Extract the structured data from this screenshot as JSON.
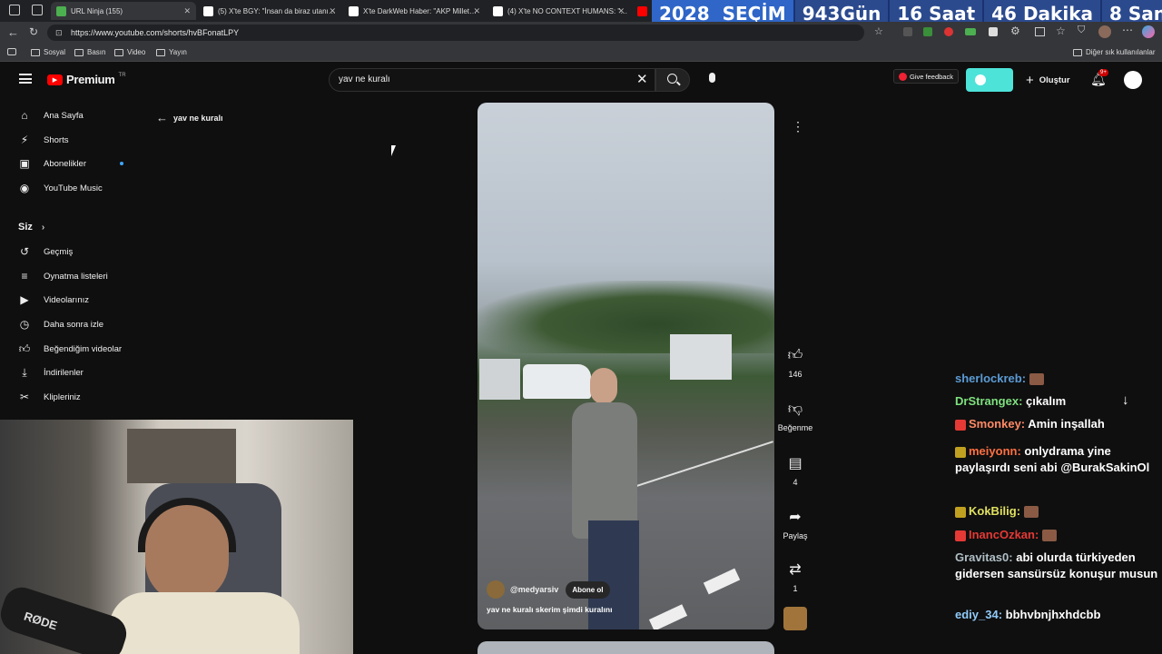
{
  "browser": {
    "tabs": [
      {
        "label": "URL Ninja (155)",
        "color": "#4caf50"
      },
      {
        "label": "(5) X'te BGY: \"İnsan da biraz utanı…",
        "color": "#ffffff"
      },
      {
        "label": "X'te DarkWeb Haber: \"AKP Millet…",
        "color": "#ffffff"
      },
      {
        "label": "(4) X'te NO CONTEXT HUMANS: \"…",
        "color": "#ffffff"
      },
      {
        "label": "",
        "color": "#ff0000"
      }
    ],
    "url": "https://www.youtube.com/shorts/hvBFonatLPY",
    "bookmarks": [
      "Sosyal",
      "Basın",
      "Video",
      "Yayın"
    ],
    "other_bookmarks": "Diğer sık kullanılanlar"
  },
  "countdown": {
    "year": "2028",
    "label": "SEÇİM",
    "days": "943",
    "days_unit": "Gün",
    "hours": "16",
    "hours_unit": "Saat",
    "minutes": "46",
    "minutes_unit": "Dakika",
    "seconds": "8",
    "seconds_unit": "Saniye"
  },
  "youtube": {
    "logo": "Premium",
    "logo_region": "TR",
    "search_value": "yav ne kuralı",
    "give_feedback": "Give feedback",
    "create_label": "Oluştur",
    "notifications": "9+",
    "back_label": "yav ne kuralı",
    "sidebar": {
      "main": [
        {
          "label": "Ana Sayfa",
          "icon": "home-icon"
        },
        {
          "label": "Shorts",
          "icon": "shorts-icon"
        },
        {
          "label": "Abonelikler",
          "icon": "subscriptions-icon"
        },
        {
          "label": "YouTube Music",
          "icon": "music-icon"
        }
      ],
      "you_header": "Siz",
      "you": [
        {
          "label": "Geçmiş",
          "icon": "history-icon"
        },
        {
          "label": "Oynatma listeleri",
          "icon": "playlist-icon"
        },
        {
          "label": "Videolarınız",
          "icon": "video-icon"
        },
        {
          "label": "Daha sonra izle",
          "icon": "clock-icon"
        },
        {
          "label": "Beğendiğim videolar",
          "icon": "like-icon"
        },
        {
          "label": "İndirilenler",
          "icon": "download-icon"
        },
        {
          "label": "Klipleriniz",
          "icon": "scissors-icon"
        }
      ]
    },
    "short": {
      "channel": "@medyarsiv",
      "subscribe": "Abone ol",
      "caption": "yav ne kuralı skerim şimdi kuralını",
      "likes": "146",
      "dislike_label": "Beğenme",
      "comments": "4",
      "share_label": "Paylaş",
      "remix": "1"
    }
  },
  "chat": [
    {
      "user": "sherlockreb:",
      "text": "",
      "color": "#5b9bd5",
      "emote": true,
      "badge": ""
    },
    {
      "user": "DrStrangex:",
      "text": "çıkalım",
      "color": "#7fe07f",
      "emote": false,
      "badge": ""
    },
    {
      "user": "Smonkey:",
      "text": "Amin inşallah",
      "color": "#ff8a65",
      "emote": false,
      "badge": "#e53935"
    },
    {
      "user": "meiyonn:",
      "text": "onlydrama yine paylaşırdı seni abi @BurakSakinOl",
      "color": "#ff7043",
      "emote": false,
      "badge": "#c0a020"
    },
    {
      "user": "KokBilig:",
      "text": "",
      "color": "#e0e060",
      "emote": true,
      "badge": "#c0a020"
    },
    {
      "user": "InancOzkan:",
      "text": "",
      "color": "#e53935",
      "emote": true,
      "badge": "#e53935"
    },
    {
      "user": "Gravitas0:",
      "text": "abi olurda türkiyeden gidersen sansürsüz konuşur musun",
      "color": "#b0bec5",
      "emote": false,
      "badge": ""
    },
    {
      "user": "ediy_34:",
      "text": "bbhvbnjhxhdcbb",
      "color": "#90caf9",
      "emote": false,
      "badge": ""
    }
  ],
  "webcam": {
    "mic_brand": "RØDE"
  }
}
